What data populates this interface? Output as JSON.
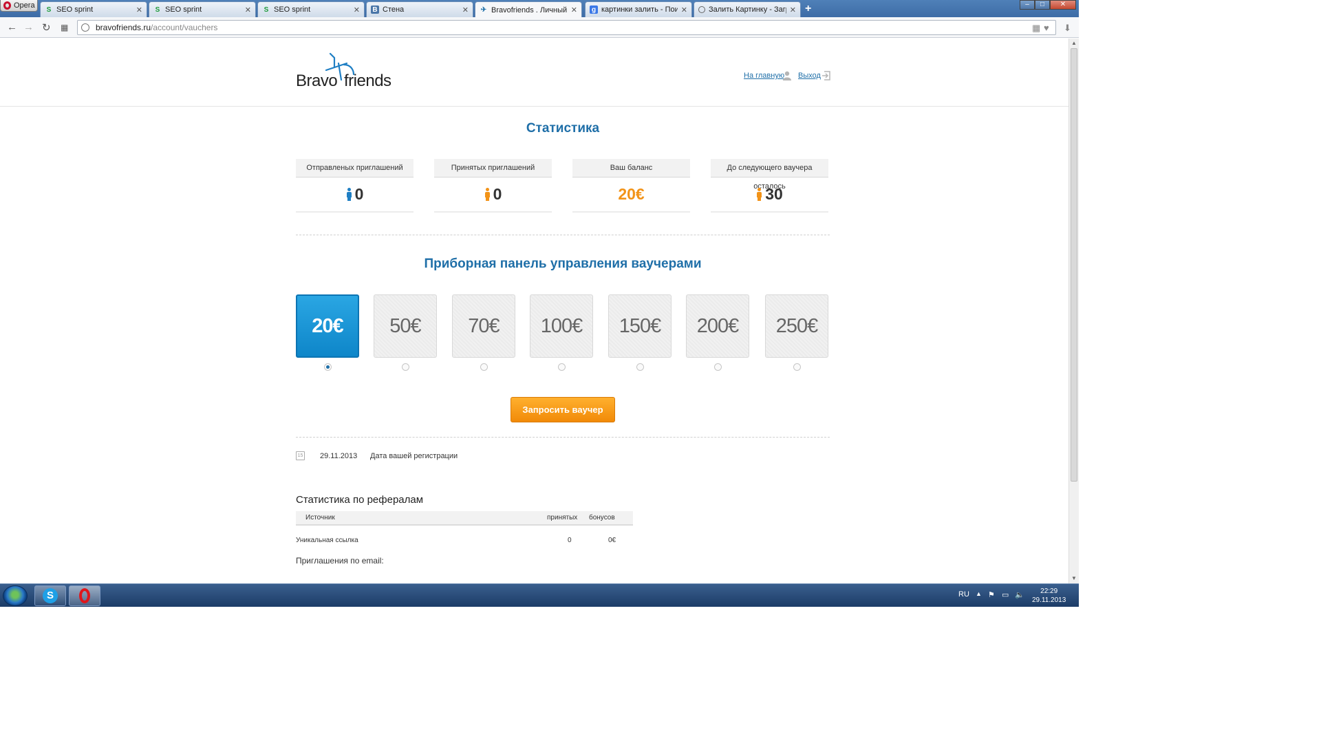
{
  "browser": {
    "menu_label": "Opera",
    "tabs": [
      {
        "title": "SEO sprint",
        "icon": "S"
      },
      {
        "title": "SEO sprint",
        "icon": "S"
      },
      {
        "title": "SEO sprint",
        "icon": "S"
      },
      {
        "title": "Стена",
        "icon": "B"
      },
      {
        "title": "Bravofriends . Личный кабинет",
        "icon": "bf"
      },
      {
        "title": "картинки залить - Поиск в Google",
        "icon": "g"
      },
      {
        "title": "Залить Картинку - Загрузить",
        "icon": "o"
      }
    ],
    "active_tab": 4,
    "url_domain": "bravofriends.ru",
    "url_path": "/account/vauchers"
  },
  "header": {
    "logo_word1": "Bravo",
    "logo_word2": "friends",
    "home_link": "На главную",
    "logout_link": "Выход"
  },
  "stats": {
    "title": "Статистика",
    "cards": [
      {
        "label": "Отправленых приглашений",
        "value": "0"
      },
      {
        "label": "Принятых приглашений",
        "value": "0"
      },
      {
        "label": "Ваш баланс",
        "value": "20€"
      },
      {
        "label": "До следующего ваучера осталось",
        "value": "30"
      }
    ]
  },
  "vouchers": {
    "title": "Приборная панель управления ваучерами",
    "options": [
      "20€",
      "50€",
      "70€",
      "100€",
      "150€",
      "200€",
      "250€"
    ],
    "selected_index": 0,
    "request_button": "Запросить ваучер"
  },
  "registration": {
    "calendar_day": "15",
    "date": "29.11.2013",
    "label": "Дата вашей регистрации"
  },
  "referrals": {
    "title": "Статистика по рефералам",
    "columns": [
      "Источник",
      "принятых",
      "бонусов"
    ],
    "rows": [
      {
        "source": "Уникальная ссылка",
        "accepted": "0",
        "bonus": "0€"
      }
    ],
    "email_label": "Приглашения по email:"
  },
  "taskbar": {
    "language": "RU",
    "time": "22:29",
    "date": "29.11.2013"
  },
  "colors": {
    "brand_blue": "#1f6fa8",
    "accent_orange": "#f29318",
    "selected_blue": "#1a95d6"
  }
}
